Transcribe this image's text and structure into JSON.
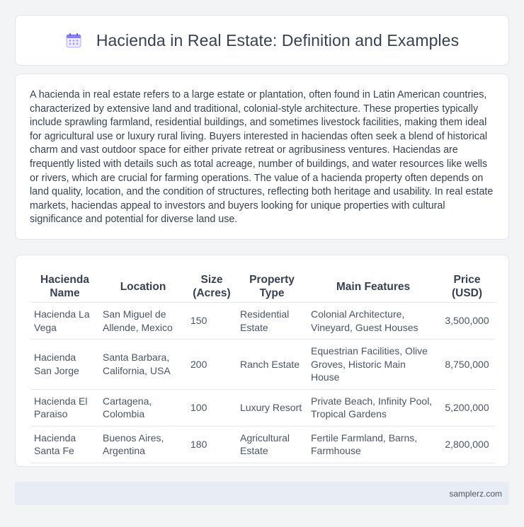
{
  "header": {
    "title": "Hacienda in Real Estate: Definition and Examples",
    "icon": "calendar-icon"
  },
  "description": "A hacienda in real estate refers to a large estate or plantation, often found in Latin American countries, characterized by extensive land and traditional, colonial-style architecture. These properties typically include sprawling farmland, residential buildings, and sometimes livestock facilities, making them ideal for agricultural use or luxury rural living. Buyers interested in haciendas often seek a blend of historical charm and vast outdoor space for either private retreat or agribusiness ventures. Haciendas are frequently listed with details such as total acreage, number of buildings, and water resources like wells or rivers, which are crucial for farming operations. The value of a hacienda property often depends on land quality, location, and the condition of structures, reflecting both heritage and usability. In real estate markets, haciendas appeal to investors and buyers looking for unique properties with cultural significance and potential for diverse land use.",
  "table": {
    "headers": [
      "Hacienda Name",
      "Location",
      "Size (Acres)",
      "Property Type",
      "Main Features",
      "Price (USD)"
    ],
    "rows": [
      [
        "Hacienda La Vega",
        "San Miguel de Allende, Mexico",
        "150",
        "Residential Estate",
        "Colonial Architecture, Vineyard, Guest Houses",
        "3,500,000"
      ],
      [
        "Hacienda San Jorge",
        "Santa Barbara, California, USA",
        "200",
        "Ranch Estate",
        "Equestrian Facilities, Olive Groves, Historic Main House",
        "8,750,000"
      ],
      [
        "Hacienda El Paraiso",
        "Cartagena, Colombia",
        "100",
        "Luxury Resort",
        "Private Beach, Infinity Pool, Tropical Gardens",
        "5,200,000"
      ],
      [
        "Hacienda Santa Fe",
        "Buenos Aires, Argentina",
        "180",
        "Agricultural Estate",
        "Fertile Farmland, Barns, Farmhouse",
        "2,800,000"
      ]
    ]
  },
  "footer": {
    "text": "samplerz.com"
  },
  "colors": {
    "background": "#f3f4f6",
    "card": "#ffffff",
    "text": "#374151",
    "footer_bg": "#e8ecf4",
    "icon_accent": "#8b7cf6"
  }
}
